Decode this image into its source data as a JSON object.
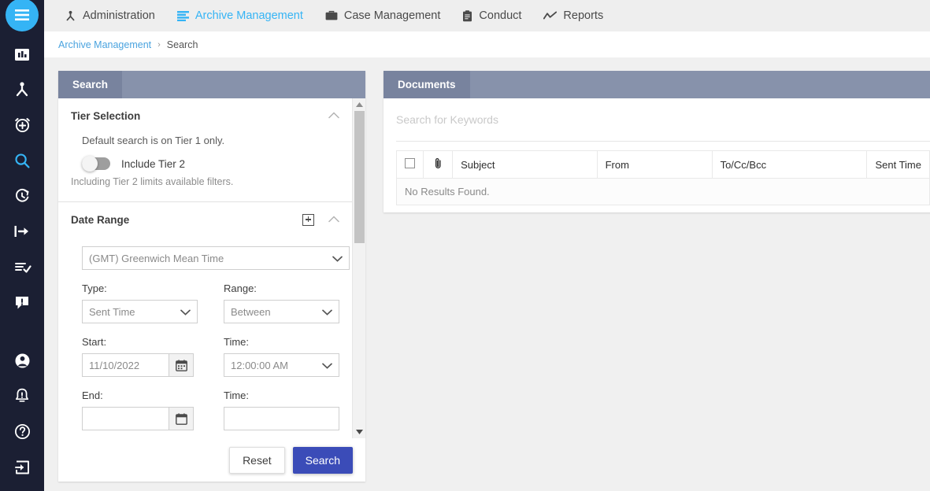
{
  "colors": {
    "rail_bg": "#1b1f33",
    "accent_blue": "#35b4f5",
    "panel_header": "#8792ab",
    "panel_tab_active": "#78839e",
    "primary_button": "#3b4cb8",
    "link": "#4aa3df"
  },
  "rail": {
    "burger": {
      "icon": "hamburger-menu-icon",
      "label": "Menu"
    },
    "items": [
      {
        "icon": "chart-bar-icon",
        "label": "Dashboard",
        "active": false
      },
      {
        "icon": "sitemap-icon",
        "label": "Administration",
        "active": false
      },
      {
        "icon": "alarm-add-icon",
        "label": "Add Alert",
        "active": false
      },
      {
        "icon": "magnifier-icon",
        "label": "Search",
        "active": true
      },
      {
        "icon": "history-clock-icon",
        "label": "Recent",
        "active": false
      },
      {
        "icon": "export-arrow-icon",
        "label": "Export",
        "active": false
      },
      {
        "icon": "list-check-icon",
        "label": "Review",
        "active": false
      },
      {
        "icon": "comment-alert-icon",
        "label": "Alerts",
        "active": false
      }
    ],
    "bottom_items": [
      {
        "icon": "user-circle-icon",
        "label": "Account"
      },
      {
        "icon": "bell-alert-icon",
        "label": "Notifications"
      },
      {
        "icon": "question-circle-icon",
        "label": "Help"
      },
      {
        "icon": "logout-icon",
        "label": "Sign Out"
      }
    ]
  },
  "topnav": {
    "items": [
      {
        "label": "Administration",
        "icon": "sitemap-icon",
        "active": false
      },
      {
        "label": "Archive Management",
        "icon": "list-lines-icon",
        "active": true
      },
      {
        "label": "Case Management",
        "icon": "briefcase-icon",
        "active": false
      },
      {
        "label": "Conduct",
        "icon": "clipboard-icon",
        "active": false
      },
      {
        "label": "Reports",
        "icon": "chart-line-icon",
        "active": false
      }
    ]
  },
  "breadcrumb": {
    "root": "Archive Management",
    "separator": "›",
    "current": "Search"
  },
  "search_panel": {
    "tab_label": "Search",
    "tier_selection": {
      "title": "Tier Selection",
      "collapse_icon": "chevron-up-icon",
      "description": "Default search is on Tier 1 only.",
      "toggle_label": "Include Tier 2",
      "toggle_on": false,
      "note": "Including Tier 2 limits available filters."
    },
    "date_range": {
      "title": "Date Range",
      "add_icon": "plus-box-icon",
      "collapse_icon": "chevron-up-icon",
      "timezone_value": "(GMT) Greenwich Mean Time",
      "fields": {
        "type_label": "Type:",
        "type_value": "Sent Time",
        "range_label": "Range:",
        "range_value": "Between",
        "start_label": "Start:",
        "start_value": "11/10/2022",
        "start_time_label": "Time:",
        "start_time_value": "12:00:00 AM",
        "end_label": "End:",
        "end_value": "",
        "end_time_label": "Time:",
        "end_time_value": ""
      },
      "calendar_icon": "calendar-icon"
    },
    "actions": {
      "reset_label": "Reset",
      "search_label": "Search"
    }
  },
  "documents_panel": {
    "tab_label": "Documents",
    "keyword_placeholder": "Search for Keywords",
    "keyword_value": "",
    "columns": [
      {
        "key": "select",
        "label": "",
        "icon": "checkbox-icon"
      },
      {
        "key": "attach",
        "label": "",
        "icon": "paperclip-icon"
      },
      {
        "key": "subject",
        "label": "Subject",
        "icon": ""
      },
      {
        "key": "from",
        "label": "From",
        "icon": ""
      },
      {
        "key": "tocc",
        "label": "To/Cc/Bcc",
        "icon": ""
      },
      {
        "key": "sent",
        "label": "Sent Time",
        "icon": ""
      }
    ],
    "rows": [],
    "empty_message": "No Results Found."
  }
}
